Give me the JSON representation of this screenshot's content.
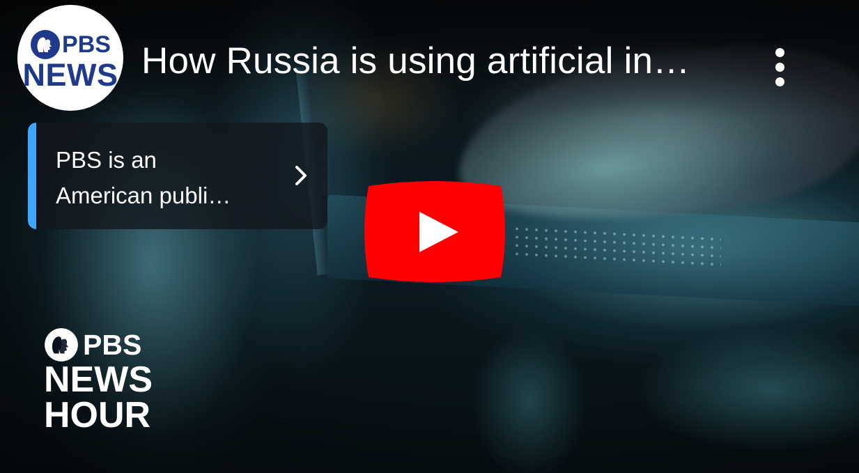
{
  "channel": {
    "logo_brand": "PBS",
    "logo_word": "NEWS",
    "logo_color": "#1f3a8a"
  },
  "video": {
    "title": "How Russia is using artificial in…"
  },
  "info_card": {
    "line1": "PBS is an",
    "line2": "American publi…",
    "accent_color": "#3ea6ff"
  },
  "play_button": {
    "color": "#ff0000",
    "icon": "play-icon"
  },
  "watermark": {
    "brand": "PBS",
    "line1": "NEWS",
    "line2": "HOUR"
  },
  "icons": {
    "menu": "more-vertical-icon",
    "chevron": "chevron-right-icon",
    "pbs_head": "pbs-heads-icon"
  }
}
